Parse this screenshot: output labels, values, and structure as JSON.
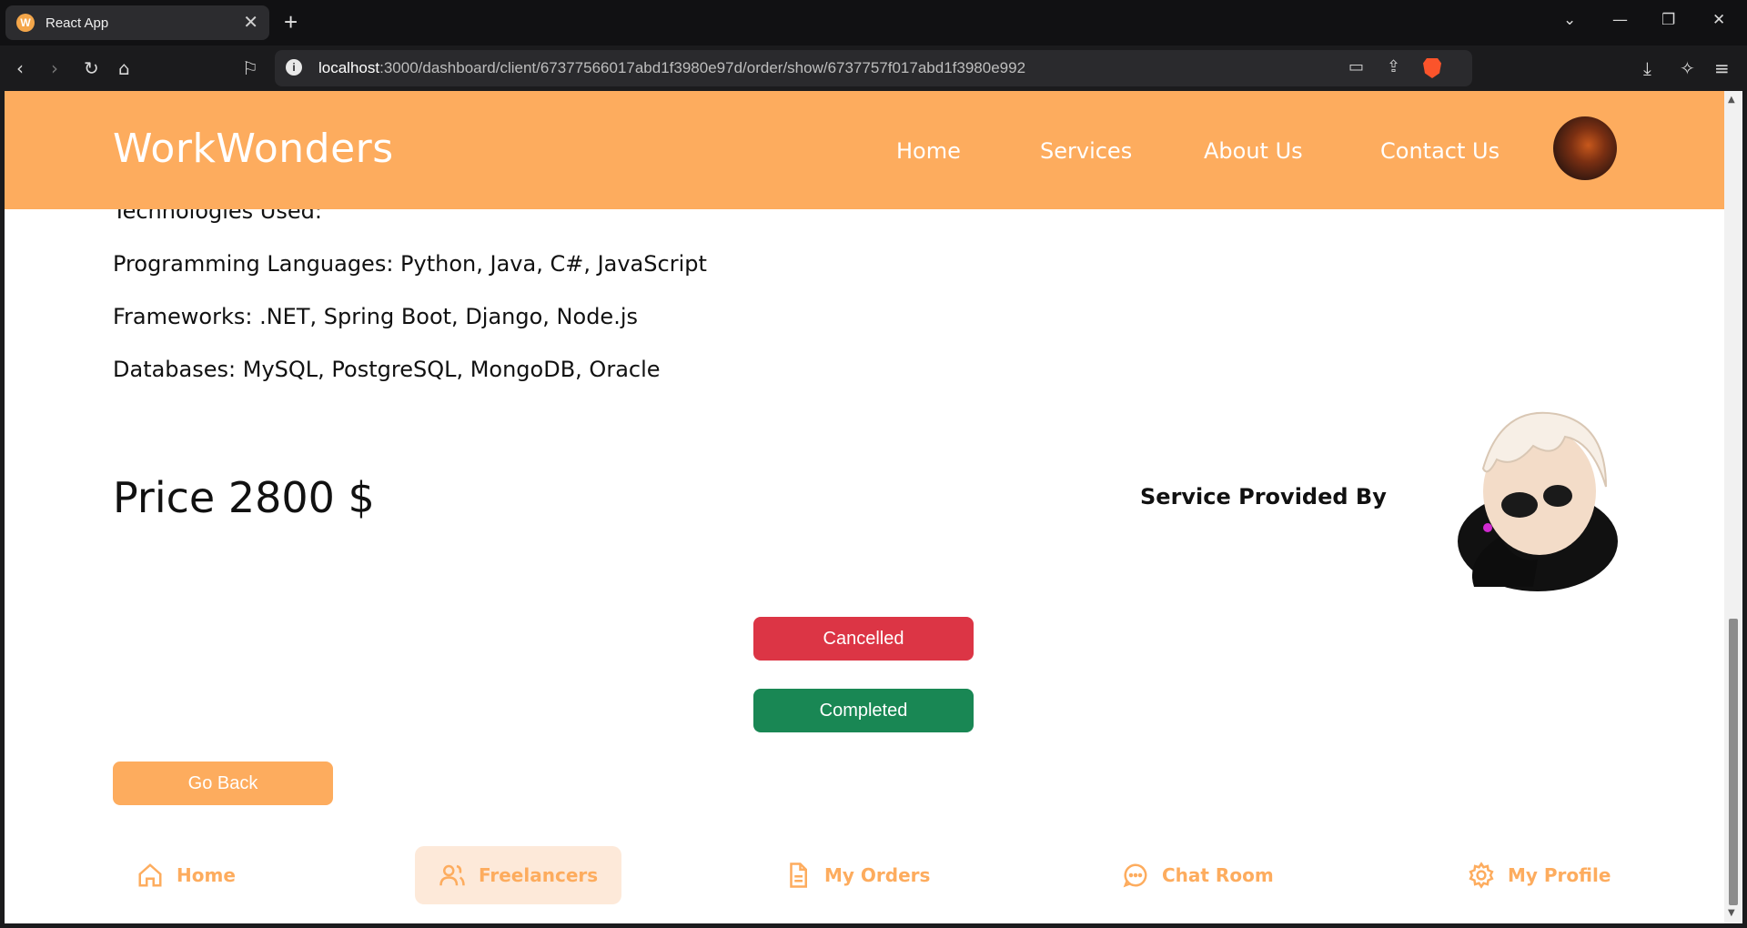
{
  "browser": {
    "tab_title": "React App",
    "tab_favicon_letter": "W",
    "url_host": "localhost",
    "url_rest": ":3000/dashboard/client/67377566017abd1f3980e97d/order/show/6737757f017abd1f3980e992"
  },
  "header": {
    "brand": "WorkWonders",
    "nav": [
      "Home",
      "Services",
      "About Us",
      "Contact Us"
    ]
  },
  "details": {
    "technologies_heading": "Technologies Used:",
    "languages": "Programming Languages: Python, Java, C#, JavaScript",
    "frameworks": "Frameworks: .NET, Spring Boot, Django, Node.js",
    "databases": "Databases: MySQL, PostgreSQL, MongoDB, Oracle"
  },
  "order": {
    "price": "Price 2800 $",
    "provided_by": "Service Provided By",
    "cancel_label": "Cancelled",
    "complete_label": "Completed",
    "back_label": "Go Back"
  },
  "bottom_nav": [
    {
      "label": "Home",
      "icon": "home-icon"
    },
    {
      "label": "Freelancers",
      "icon": "users-icon",
      "active": true
    },
    {
      "label": "My Orders",
      "icon": "document-icon"
    },
    {
      "label": "Chat Room",
      "icon": "chat-icon"
    },
    {
      "label": "My Profile",
      "icon": "gear-icon"
    }
  ],
  "colors": {
    "brand_orange": "#fdac5e",
    "cancel_red": "#dc3545",
    "complete_green": "#198754",
    "active_bg": "#fde9d9"
  }
}
